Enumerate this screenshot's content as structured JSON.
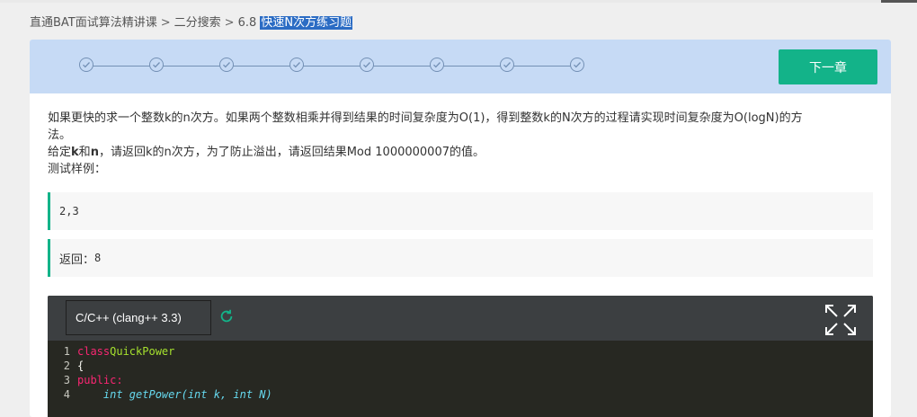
{
  "breadcrumb": {
    "course": "直通BAT面试算法精讲课",
    "chapter": "二分搜索",
    "section_no": "6.8",
    "current": "快速N次方练习题",
    "separator": ">"
  },
  "progress": {
    "steps_total": 8,
    "steps_completed": 8
  },
  "next_button": {
    "label": "下一章"
  },
  "problem": {
    "line1": "如果更快的求一个整数k的n次方。如果两个整数相乘并得到结果的时间复杂度为O(1)，得到整数k的N次方的过程请实现时间复杂度为O(logN)的方",
    "line2": "法。",
    "line3_prefix": "给定",
    "line3_k": "k",
    "line3_and": "和",
    "line3_n": "n",
    "line3_rest": "，请返回k的n次方，为了防止溢出，请返回结果Mod 1000000007的值。",
    "line4": "测试样例："
  },
  "sample_input": "2,3",
  "sample_output": {
    "label": "返回：",
    "value": "8"
  },
  "editor": {
    "language": "C/C++ (clang++ 3.3)",
    "lines": [
      {
        "no": "1",
        "kw": "class",
        "name": "QuickPower"
      },
      {
        "no": "2",
        "text": "{"
      },
      {
        "no": "3",
        "text": "public:"
      },
      {
        "no": "4",
        "text": "    int getPower(int k, int N)"
      }
    ]
  },
  "colors": {
    "accent": "#13b389",
    "progress_bg": "#c6daf5",
    "breadcrumb_highlight": "#2b6cc4",
    "editor_bg": "#272822"
  }
}
